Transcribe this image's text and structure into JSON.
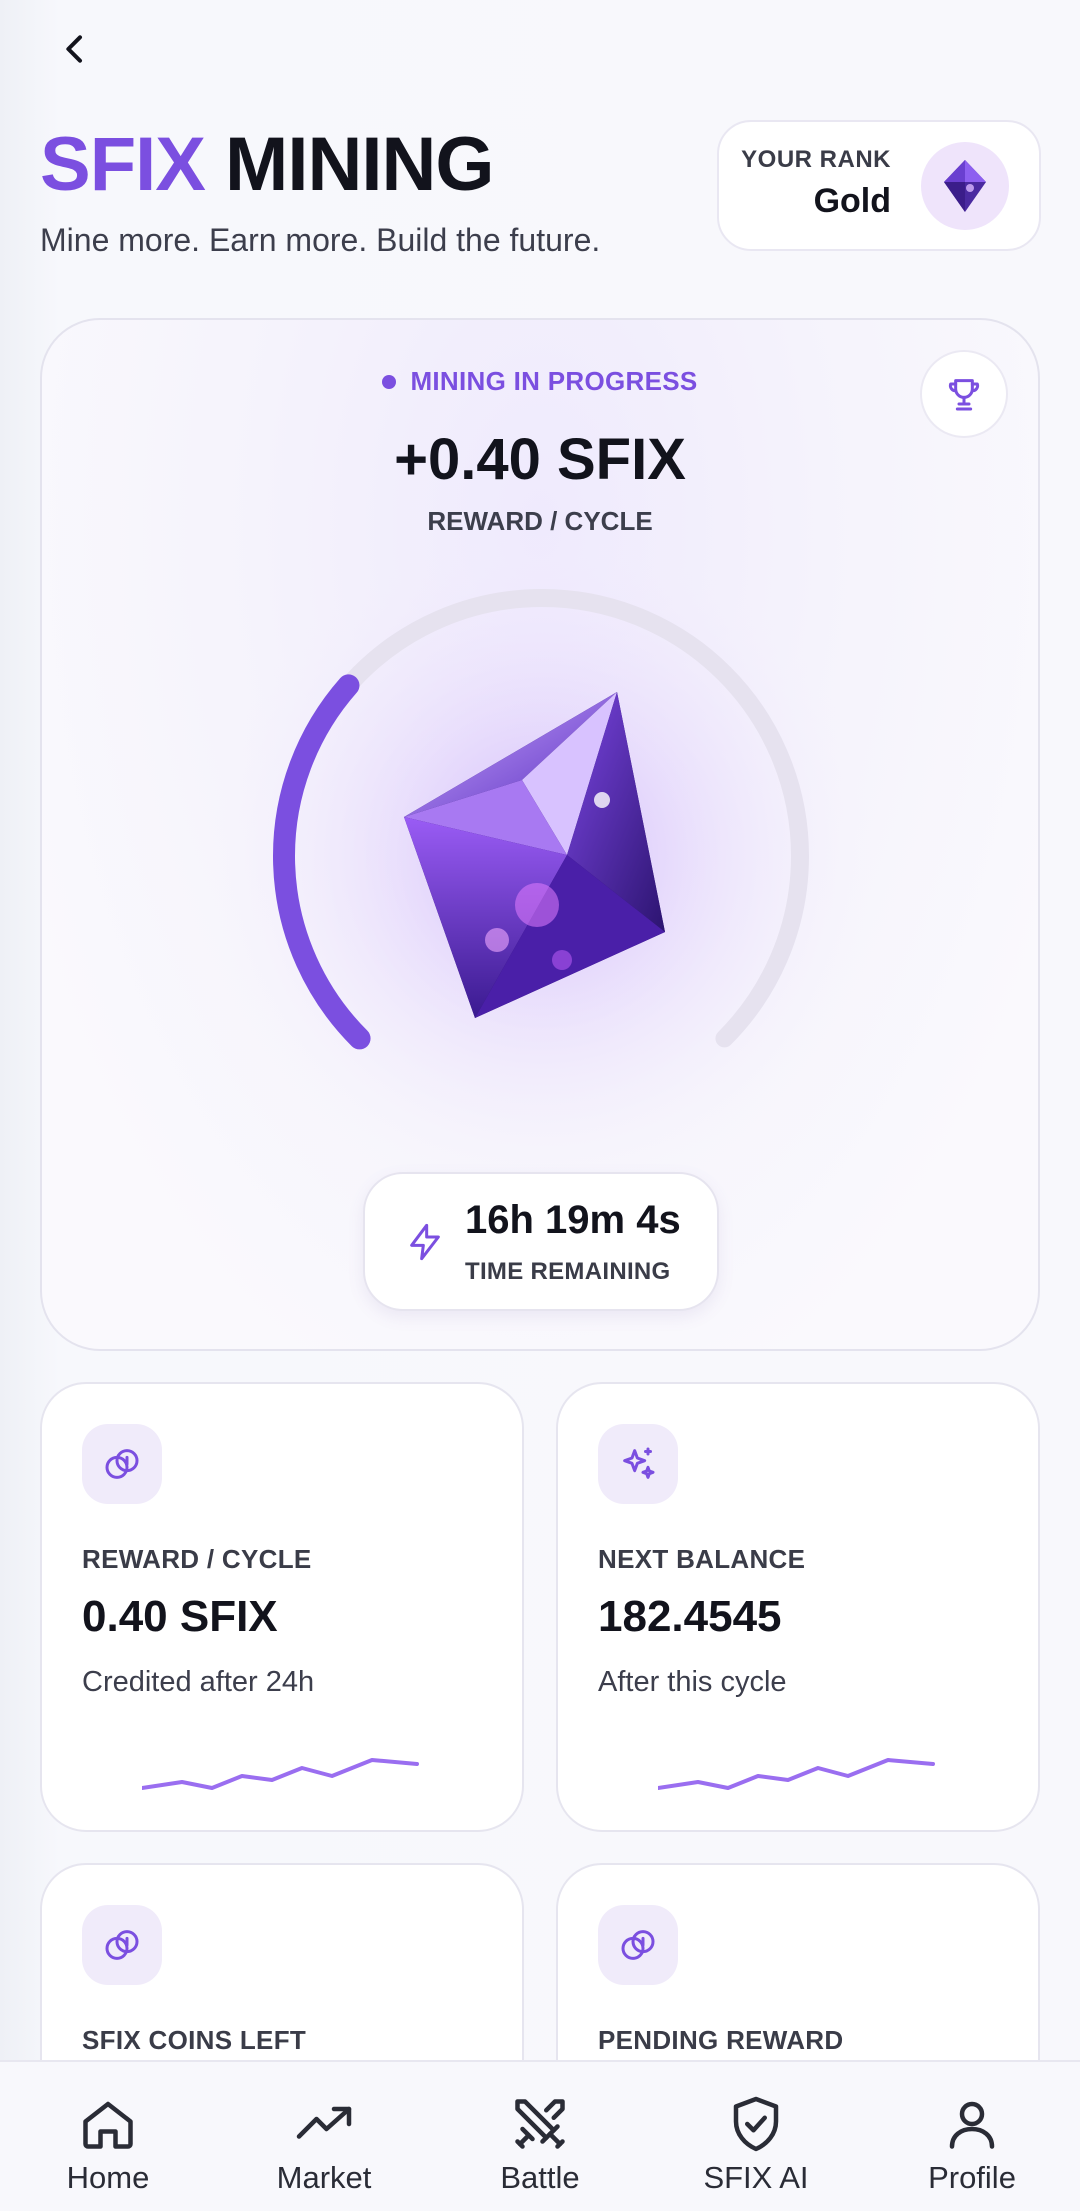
{
  "header": {
    "back_icon": "chevron-left-icon",
    "title_accent": "SFIX",
    "title_main": "MINING",
    "subtitle": "Mine more. Earn more. Build the future."
  },
  "rank": {
    "label": "YOUR RANK",
    "value": "Gold",
    "icon": "gem-icon"
  },
  "mining": {
    "status": "MINING IN PROGRESS",
    "reward": "+0.40 SFIX",
    "reward_label": "REWARD / CYCLE",
    "trophy_icon": "trophy-icon",
    "progress_fraction": 0.32,
    "timer_value": "16h 19m 4s",
    "timer_label": "TIME REMAINING",
    "timer_icon": "lightning-icon"
  },
  "stats": [
    {
      "icon": "coins-icon",
      "label": "REWARD / CYCLE",
      "value": "0.40 SFIX",
      "note": "Credited after 24h"
    },
    {
      "icon": "sparkles-icon",
      "label": "NEXT BALANCE",
      "value": "182.4545",
      "note": "After this cycle"
    },
    {
      "icon": "coins-icon",
      "label": "SFIX COINS LEFT",
      "value": "",
      "note": ""
    },
    {
      "icon": "coins-icon",
      "label": "PENDING REWARD",
      "value": "",
      "note": ""
    }
  ],
  "nav": [
    {
      "label": "Home",
      "icon": "home-icon"
    },
    {
      "label": "Market",
      "icon": "trending-up-icon"
    },
    {
      "label": "Battle",
      "icon": "crossed-swords-icon"
    },
    {
      "label": "SFIX AI",
      "icon": "shield-check-icon"
    },
    {
      "label": "Profile",
      "icon": "user-icon"
    }
  ],
  "colors": {
    "accent": "#7b4fe0",
    "text": "#12131c",
    "gem_dark": "#3b1d8a",
    "gem_light": "#b98cf6"
  }
}
